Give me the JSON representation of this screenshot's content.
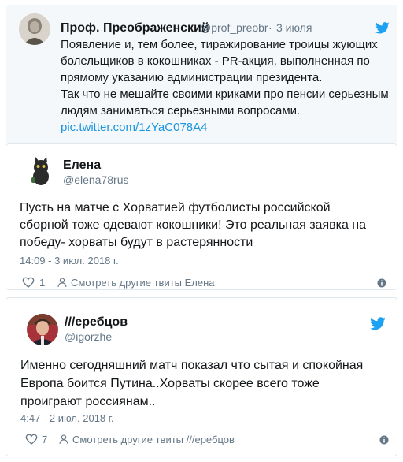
{
  "tweet1": {
    "name": "Проф. Преображенский",
    "handle": "@prof_preobr",
    "dot": "·",
    "date": "3 июля",
    "lines": [
      "Появление и, тем более, тиражирование троицы жующих",
      "болельщиков в кокошниках - PR-акция, выполненная по",
      "прямому указанию администрации президента.",
      "Так что не мешайте своими криками про пенсии серьезным",
      "людям заниматься серьезными вопросами."
    ],
    "link": "pic.twitter.com/1zYaC078A4",
    "icon": "twitter-bird-icon"
  },
  "tweet2": {
    "name": "Елена",
    "handle": "@elena78rus",
    "lines": [
      "Пусть на матче с Хорватией футболисты российской",
      "сборной тоже одевают кокошники! Это реальная заявка на",
      "победу- хорваты будут в растерянности"
    ],
    "timestamp": "14:09 - 3 июл. 2018 г.",
    "like_count": "1",
    "more_label": "Смотреть другие твиты Елена"
  },
  "tweet3": {
    "name": "///еребцов",
    "handle": "@igorzhe",
    "lines": [
      "Именно сегодняшний матч показал что сытая и спокойная",
      "Европа боится Путина..Хорваты скорее всего тоже",
      "проиграют россиянам.."
    ],
    "timestamp": "4:47 - 2 июл. 2018 г.",
    "like_count": "7",
    "more_label": "Смотреть другие твиты ///еребцов"
  },
  "colors": {
    "twitter_blue": "#1da1f2",
    "link": "#1b95e0",
    "secondary": "#657786",
    "border": "#e1e8ed"
  }
}
